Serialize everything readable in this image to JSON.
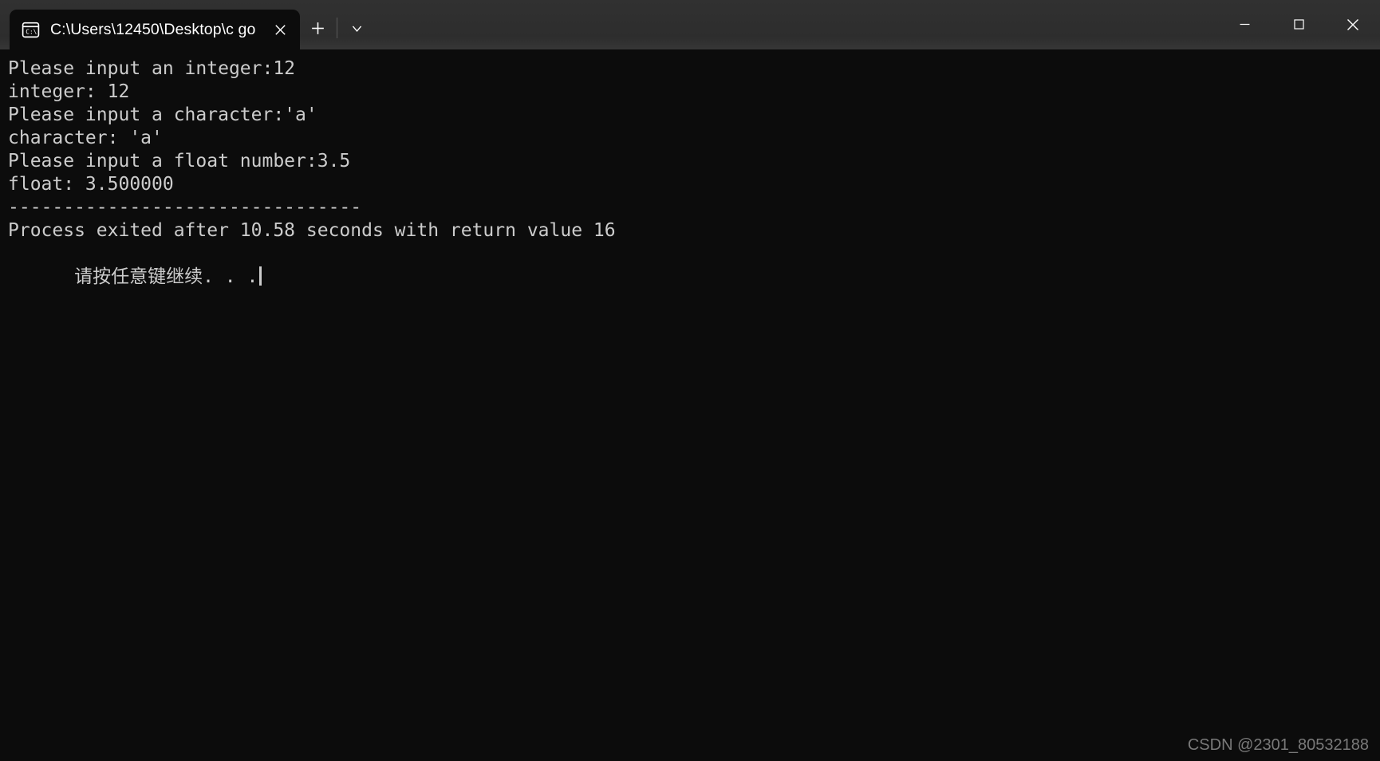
{
  "window": {
    "tab": {
      "icon": "command-prompt-icon",
      "title": "C:\\Users\\12450\\Desktop\\c go",
      "close_label": "✕"
    },
    "new_tab_label": "+",
    "tab_dropdown_label": "⌄",
    "controls": {
      "minimize_label": "─",
      "maximize_label": "☐",
      "close_label": "✕"
    },
    "colors": {
      "titlebar": "#2d2d2d",
      "terminal_background": "#0c0c0c",
      "terminal_foreground": "#cccccc"
    }
  },
  "terminal": {
    "lines": [
      "Please input an integer:12",
      "integer: 12",
      "Please input a character:'a'",
      "character: 'a'",
      "Please input a float number:3.5",
      "float: 3.500000",
      "",
      "--------------------------------",
      "Process exited after 10.58 seconds with return value 16"
    ],
    "prompt_line": "请按任意键继续. . .",
    "cursor_visible": true
  },
  "watermark": {
    "text": "CSDN @2301_80532188"
  }
}
